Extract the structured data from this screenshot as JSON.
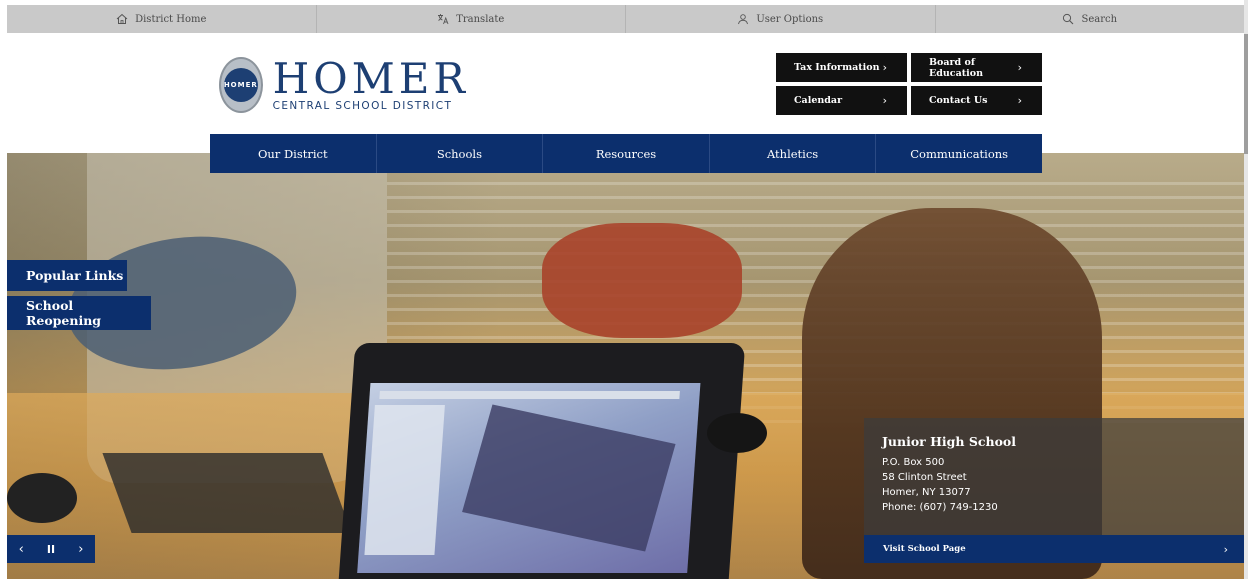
{
  "topbar": {
    "items": [
      {
        "label": "District Home",
        "icon": "home-icon"
      },
      {
        "label": "Translate",
        "icon": "translate-icon"
      },
      {
        "label": "User Options",
        "icon": "user-icon"
      },
      {
        "label": "Search",
        "icon": "search-icon"
      }
    ]
  },
  "logo": {
    "seal_text": "HOMER",
    "title": "HOMER",
    "subtitle": "CENTRAL SCHOOL DISTRICT"
  },
  "quick_links": [
    {
      "label": "Tax Information"
    },
    {
      "label": "Board of Education"
    },
    {
      "label": "Calendar"
    },
    {
      "label": "Contact Us"
    }
  ],
  "main_nav": {
    "items": [
      {
        "label": "Our District"
      },
      {
        "label": "Schools"
      },
      {
        "label": "Resources"
      },
      {
        "label": "Athletics"
      },
      {
        "label": "Communications"
      }
    ]
  },
  "side_buttons": {
    "popular_links": "Popular Links",
    "school_reopening": "School Reopening"
  },
  "slider": {
    "prev": "‹",
    "pause": "II",
    "next": "›"
  },
  "school_info": {
    "name": "Junior High School",
    "po_box": "P.O. Box 500",
    "street": "58 Clinton Street",
    "city": "Homer, NY 13077",
    "phone": "Phone: (607) 749-1230",
    "visit_label": "Visit School Page",
    "visit_chevron": "›"
  },
  "colors": {
    "brand_navy": "#0c2f6d",
    "topbar_gray": "#c9c9c9",
    "quick_link_black": "#111111"
  }
}
